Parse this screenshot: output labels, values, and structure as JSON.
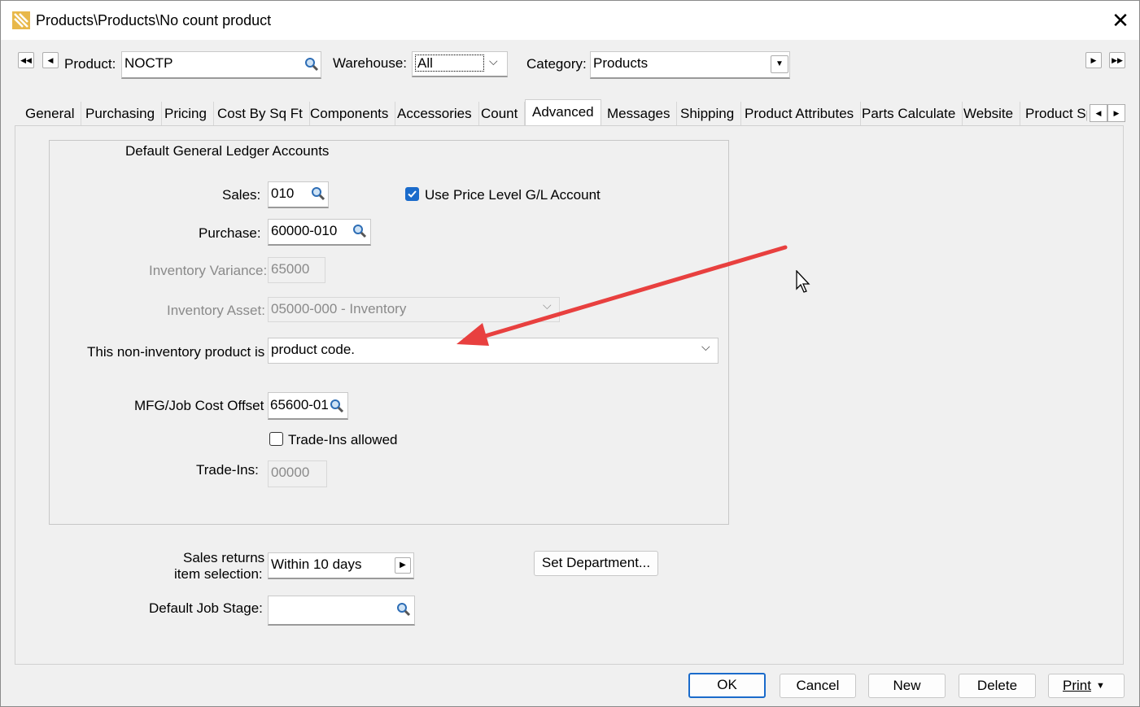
{
  "window": {
    "title": "Products\\Products\\No count product"
  },
  "toolbar": {
    "product_label": "Product:",
    "product_value": "NOCTP",
    "warehouse_label": "Warehouse:",
    "warehouse_value": "All",
    "category_label": "Category:",
    "category_value": "Products"
  },
  "tabs": [
    {
      "label": "General"
    },
    {
      "label": "Purchasing"
    },
    {
      "label": "Pricing"
    },
    {
      "label": "Cost By Sq Ft"
    },
    {
      "label": "Components"
    },
    {
      "label": "Accessories"
    },
    {
      "label": "Count"
    },
    {
      "label": "Advanced",
      "active": true
    },
    {
      "label": "Messages"
    },
    {
      "label": "Shipping"
    },
    {
      "label": "Product Attributes"
    },
    {
      "label": "Parts Calculate"
    },
    {
      "label": "Website"
    },
    {
      "label": "Product Sp"
    }
  ],
  "gl": {
    "group_title": "Default General Ledger Accounts",
    "sales_label": "Sales:",
    "sales_value": "010",
    "use_price_level_label": "Use Price Level G/L Account",
    "use_price_level_checked": true,
    "purchase_label": "Purchase:",
    "purchase_value": "60000-010",
    "inventory_variance_label": "Inventory Variance:",
    "inventory_variance_value": "65000",
    "inventory_asset_label": "Inventory Asset:",
    "inventory_asset_value": "05000-000 - Inventory",
    "non_inventory_label": "This non-inventory product is a",
    "non_inventory_value": "product code.",
    "mfg_label": "MFG/Job Cost Offset",
    "mfg_value": "65600-01",
    "trade_ins_allowed_label": "Trade-Ins allowed",
    "trade_ins_allowed_checked": false,
    "trade_ins_label": "Trade-Ins:",
    "trade_ins_value": "00000"
  },
  "lower": {
    "sales_returns_label_1": "Sales returns",
    "sales_returns_label_2": "item selection:",
    "sales_returns_value": "Within 10  days",
    "set_department_label": "Set Department...",
    "default_job_stage_label": "Default Job Stage:",
    "default_job_stage_value": ""
  },
  "footer": {
    "ok": "OK",
    "cancel": "Cancel",
    "new": "New",
    "delete": "Delete",
    "print": "Print"
  },
  "colors": {
    "accent": "#1a6bcb",
    "annotation_arrow": "#e8403f"
  },
  "icons": [
    "app-icon",
    "close-icon",
    "first-record-icon",
    "prev-record-icon",
    "next-record-icon",
    "last-record-icon",
    "magnifier-icon",
    "chevron-down-icon",
    "mouse-cursor-icon",
    "annotation-arrow"
  ]
}
